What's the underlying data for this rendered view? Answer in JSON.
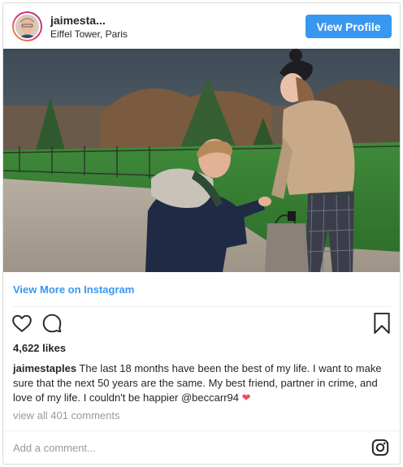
{
  "header": {
    "username": "jaimesta...",
    "location": "Eiffel Tower, Paris",
    "view_profile_label": "View Profile"
  },
  "post": {
    "view_more_label": "View More on Instagram",
    "likes": "4,622 likes",
    "caption_user": "jaimestaples",
    "caption_text": " The last 18 months have been the best of my life. I want to make sure that the next 50 years are the same. My best friend, partner in crime, and love of my life. I couldn't be happier ",
    "caption_mention": "@beccarr94",
    "view_comments": "view all 401 comments",
    "add_comment_placeholder": "Add a comment..."
  },
  "icons": {
    "like": "heart-outline-icon",
    "comment": "comment-bubble-icon",
    "save": "bookmark-icon",
    "brand": "instagram-logo-icon",
    "caption_emoji": "red-heart-emoji"
  },
  "colors": {
    "accent": "#3897f0",
    "text": "#262626",
    "muted": "#999999",
    "heart": "#ed4956"
  }
}
